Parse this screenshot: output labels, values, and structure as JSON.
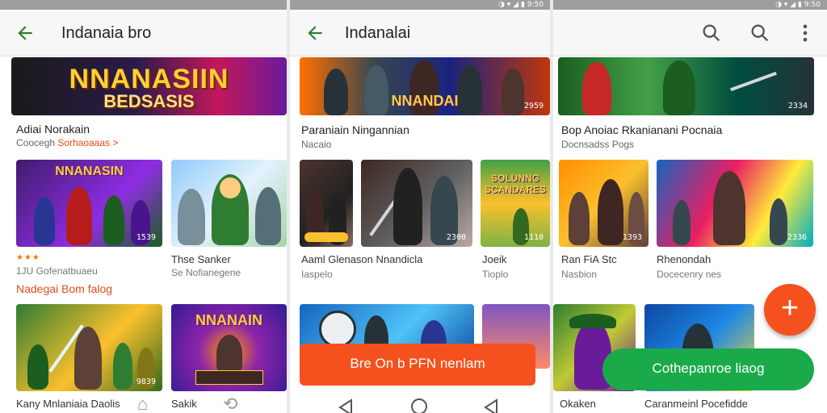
{
  "status": {
    "icons": "◑ ▾ ◢ ▮ 9:50"
  },
  "panel1": {
    "title": "Indanaia bro",
    "banner": {
      "line1": "NNANASIIN",
      "line2": "BEDSASIS"
    },
    "section1": {
      "title": "Adiai Norakain",
      "sub_prefix": "Coocegh",
      "sub_link": "Sorhaoaaas >"
    },
    "tiles_row1": [
      {
        "title": "NNANASIN",
        "badge": "1539",
        "stars": "★★★",
        "label": "1JU Gofenatbuaeu",
        "colors": [
          "#3f1c6e",
          "#8e2de2",
          "#1b5e20"
        ]
      },
      {
        "title": "",
        "badge": "",
        "stars": "",
        "label": "Thse Sanker",
        "sub": "Se Nofianegene",
        "colors": [
          "#90caf9",
          "#2e7d32",
          "#a5d6a7"
        ]
      }
    ],
    "section2": {
      "title": "Nadegai Bom falog"
    },
    "tiles_row2": [
      {
        "title": "",
        "badge": "9839",
        "label": "Kany Mnlaniaia Daolis",
        "colors": [
          "#2e7d32",
          "#fbc02d",
          "#33691e"
        ]
      },
      {
        "title": "NNANAIN",
        "badge": "",
        "label": "Sakik",
        "colors": [
          "#311b92",
          "#8e24aa",
          "#ff9800"
        ]
      }
    ]
  },
  "panel2": {
    "title": "Indanalai",
    "banner": {
      "line1": "NNANDAI",
      "badge": "2959"
    },
    "section1": {
      "title": "Paraniain Ningannian",
      "sub": "Nacaio"
    },
    "tiles_row1": [
      {
        "badge": "",
        "label": "Aaml Glenason Nnandicla",
        "sub": "Iaspelo",
        "colors": [
          "#4e342e",
          "#212121",
          "#8d6e63"
        ]
      },
      {
        "badge": "2300",
        "colors": [
          "#3e2723",
          "#616161",
          "#bcaaa4"
        ]
      },
      {
        "title": "SOLUNNG SCANDARES",
        "badge": "1110",
        "label": "Joeik",
        "sub": "Tioplo",
        "colors": [
          "#43a047",
          "#fbc02d",
          "#7cb342"
        ]
      }
    ],
    "cta": {
      "label": "Bre On b PFN nenlam"
    }
  },
  "panel3": {
    "banner": {
      "badge": "2334"
    },
    "section1": {
      "title": "Bop Anoiac Rkanianani Pocnaia",
      "sub": "Docnsadss Pogs"
    },
    "tiles_row1": [
      {
        "badge": "1393",
        "label": "Ran FiA Stc",
        "sub": "Nasbion",
        "colors": [
          "#ff8f00",
          "#fbc02d",
          "#5d4037"
        ]
      },
      {
        "badge": "2336",
        "label": "Rhenondah",
        "sub": "Docecenry nes",
        "colors": [
          "#1565c0",
          "#e91e63",
          "#ffeb3b"
        ]
      }
    ],
    "tiles_row2": [
      {
        "label": "Okaken",
        "colors": [
          "#2e7d32",
          "#6a1b9a",
          "#c0ca33"
        ]
      },
      {
        "label": "Caranmeinl Pocefidde",
        "colors": [
          "#0d47a1",
          "#fdd835",
          "#1e88e5"
        ]
      }
    ],
    "cta": {
      "label": "Cothepanroe liaog"
    },
    "fab": {
      "symbol": "+"
    }
  }
}
